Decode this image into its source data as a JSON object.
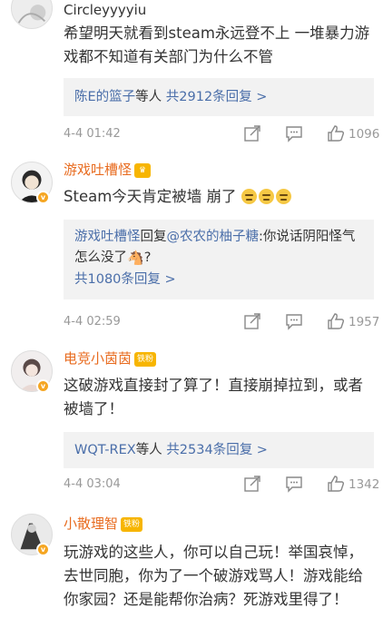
{
  "comments": [
    {
      "username": "Circleyyyyiu",
      "text": "希望明天就看到steam永远登不上 一堆暴力游戏都不知道有关部门为什么不管",
      "reply_summary": {
        "names": "陈E的篮子",
        "etc": "等人",
        "count_text": "共2912条回复 >"
      },
      "time": "4-4 01:42",
      "likes": "1096"
    },
    {
      "username": "游戏吐槽怪",
      "level_badge": "",
      "text": "Steam今天肯定被墙 崩了",
      "reply_preview": {
        "author": "游戏吐槽怪",
        "verb": "回复",
        "mention": "@农农的柚子糖",
        "text": ":你说话阴阳怪气 怎么没了",
        "count_text": "共1080条回复 >"
      },
      "time": "4-4 02:59",
      "likes": "1957"
    },
    {
      "username": "电竞小茵茵",
      "level_badge": "铁粉",
      "text": "这破游戏直接封了算了！直接崩掉拉到，或者被墙了！",
      "reply_summary": {
        "names": "WQT-REX",
        "etc": "等人",
        "count_text": "共2534条回复 >"
      },
      "time": "4-4 03:04",
      "likes": "1342"
    },
    {
      "username": "小散理智",
      "level_badge": "铁粉",
      "text": "玩游戏的这些人，你可以自己玩！举国哀悼，去世同胞，你为了一个破游戏骂人！游戏能给你家园？还是能帮你治病？死游戏里得了！"
    }
  ],
  "icons": {
    "share": "share-icon",
    "comment": "comment-icon",
    "like": "like-icon"
  },
  "colors": {
    "link": "#4a6ea9",
    "vip_name": "#e86b1f",
    "badge": "#f7b500",
    "reply_bg": "#f2f2f2"
  }
}
